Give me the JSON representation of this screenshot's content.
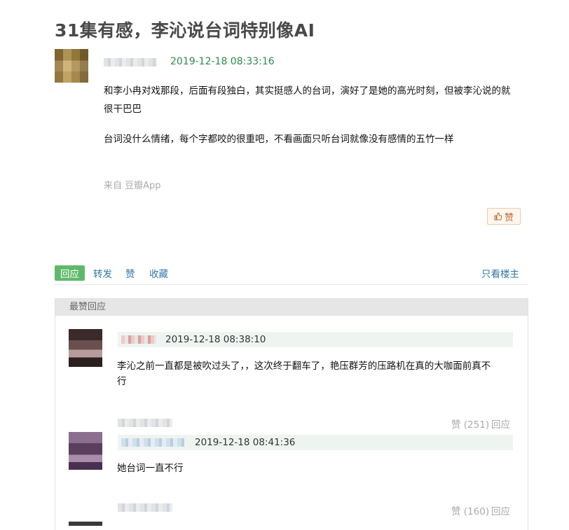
{
  "post": {
    "title": "31集有感，李沁说台词特别像AI",
    "timestamp": "2019-12-18 08:33:16",
    "paragraph1_line1": "和李小冉对戏那段，后面有段独白，其实挺感人的台词，演好了是她的高光时刻，但被李沁说的就",
    "paragraph1_line2": "很干巴巴",
    "paragraph2": "台词没什么情绪，每个字都咬的很重吧，不看画面只听台词就像没有感情的五竹一样",
    "source": "来自 豆瓣App",
    "like_label": "赞"
  },
  "actions": {
    "reply": "回应",
    "forward": "转发",
    "like": "赞",
    "collect": "收藏",
    "only_op": "只看楼主"
  },
  "top_replies": {
    "header": "最赞回应",
    "items": [
      {
        "timestamp": "2019-12-18 08:38:10",
        "text_line1": "李沁之前一直都是被吹过头了，，这次终于翻车了，艳压群芳的压路机在真的大咖面前真不",
        "text_line2": "行",
        "like_text": "赞 (251)",
        "reply_text": "回应"
      },
      {
        "timestamp": "2019-12-18 08:41:36",
        "text_line1": "她台词一直不行",
        "like_text": "赞 (160)",
        "reply_text": "回应"
      }
    ]
  },
  "colors": {
    "timestamp_green": "#2f8a4c",
    "link_blue": "#3377aa",
    "reply_button_green": "#5fb96b",
    "panel_header_gray": "#e6e6e6"
  }
}
